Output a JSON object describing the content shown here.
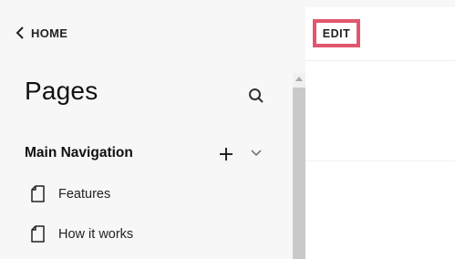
{
  "header": {
    "home_label": "HOME"
  },
  "sidebar": {
    "title": "Pages",
    "section_title": "Main Navigation",
    "items": [
      {
        "label": "Features",
        "icon": "page-icon"
      },
      {
        "label": "How it works",
        "icon": "page-icon"
      }
    ]
  },
  "preview": {
    "edit_label": "EDIT"
  },
  "colors": {
    "highlight": "#e0566f",
    "sidebar_bg": "#f7f7f7",
    "preview_bg": "#ffffff"
  }
}
